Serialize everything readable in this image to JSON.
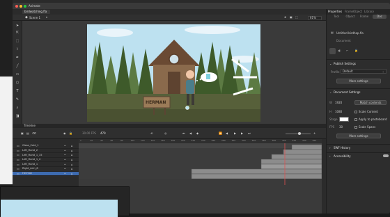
{
  "app": {
    "name": "Animate",
    "document_tab": "birdwatching.fla",
    "scene": "Scene 1",
    "zoom": "61%"
  },
  "stage": {
    "sign_text": "HERMAN"
  },
  "timeline": {
    "title": "Timeline",
    "fps": "30.00 FPS",
    "frame": "479",
    "layers": [
      {
        "name": "Glass_Cold_1",
        "selected": false
      },
      {
        "name": "Left_Hand_2",
        "selected": false
      },
      {
        "name": "Left_Hand_1_15",
        "selected": false
      },
      {
        "name": "Left_Hand_1_4",
        "selected": false
      },
      {
        "name": "Left_Hand_1",
        "selected": false
      },
      {
        "name": "Right_Arm_8",
        "selected": false
      },
      {
        "name": "Herman",
        "selected": true
      }
    ],
    "ruler": [
      "1",
      "20",
      "40",
      "60",
      "80",
      "100",
      "120",
      "140",
      "160",
      "180",
      "200",
      "220",
      "240",
      "260",
      "280",
      "300",
      "320",
      "340",
      "360",
      "380",
      "400",
      "420",
      "440",
      "460"
    ]
  },
  "properties": {
    "tabs": [
      "Properties",
      "Frame",
      "Object",
      "Library"
    ],
    "subtabs": [
      "Tool",
      "Object",
      "Frame",
      "Doc"
    ],
    "doc_name": "Untitled-birdhop.fla",
    "doc_type": "Document",
    "publish_settings": {
      "title": "Publish Settings",
      "profile_label": "Profile",
      "profile_value": "Default",
      "more_settings": "More settings"
    },
    "document_settings": {
      "title": "Document Settings",
      "width_value": "1920",
      "height_value": "1080",
      "match_contents": "Match contents",
      "scale_content": "Scale Content",
      "stage_label": "Stage",
      "apply_pasteboard": "Apply to pasteboard",
      "fps_label": "FPS",
      "fps_value": "30",
      "scale_spans": "Scale Spans",
      "more_settings": "More settings"
    },
    "swf_history": "SWF History",
    "accessibility": "Accessibility"
  },
  "colors": {
    "accent": "#3d6bb0",
    "stage_sky": "#bde1f0",
    "tree_dark": "#3e5a2a",
    "house": "#8a6a4c",
    "ground": "#57603a"
  }
}
